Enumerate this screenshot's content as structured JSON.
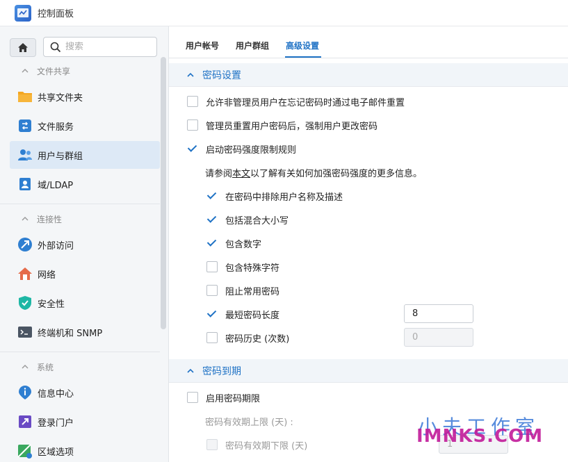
{
  "window": {
    "title": "控制面板"
  },
  "search": {
    "placeholder": "搜索"
  },
  "sidebar": {
    "groups": [
      {
        "label": "文件共享"
      },
      {
        "label": "连接性"
      },
      {
        "label": "系统"
      }
    ],
    "items": [
      {
        "label": "共享文件夹",
        "icon": "folder-icon"
      },
      {
        "label": "文件服务",
        "icon": "file-services-icon"
      },
      {
        "label": "用户与群组",
        "icon": "users-icon",
        "active": true
      },
      {
        "label": "域/LDAP",
        "icon": "domain-icon"
      },
      {
        "label": "外部访问",
        "icon": "external-access-icon"
      },
      {
        "label": "网络",
        "icon": "network-icon"
      },
      {
        "label": "安全性",
        "icon": "shield-icon"
      },
      {
        "label": "终端机和 SNMP",
        "icon": "terminal-icon"
      },
      {
        "label": "信息中心",
        "icon": "info-icon"
      },
      {
        "label": "登录门户",
        "icon": "login-portal-icon"
      },
      {
        "label": "区域选项",
        "icon": "region-icon"
      }
    ]
  },
  "tabs": [
    {
      "label": "用户帐号"
    },
    {
      "label": "用户群组"
    },
    {
      "label": "高级设置",
      "active": true
    }
  ],
  "password_settings": {
    "title": "密码设置",
    "options": [
      {
        "label": "允许非管理员用户在忘记密码时通过电子邮件重置",
        "checked": false
      },
      {
        "label": "管理员重置用户密码后，强制用户更改密码",
        "checked": false
      },
      {
        "label": "启动密码强度限制规则",
        "checked": true
      }
    ],
    "hint_prefix": "请参阅",
    "hint_link": "本文",
    "hint_suffix": "以了解有关如何加强密码强度的更多信息。",
    "rules": [
      {
        "label": "在密码中排除用户名称及描述",
        "checked": true
      },
      {
        "label": "包括混合大小写",
        "checked": true
      },
      {
        "label": "包含数字",
        "checked": true
      },
      {
        "label": "包含特殊字符",
        "checked": false
      },
      {
        "label": "阻止常用密码",
        "checked": false
      },
      {
        "label": "最短密码长度",
        "checked": true,
        "value": "8"
      },
      {
        "label": "密码历史 (次数)",
        "checked": false,
        "value": "0"
      }
    ]
  },
  "password_expiry": {
    "title": "密码到期",
    "enable_label": "启用密码期限",
    "upper_limit_label": "密码有效期上限 (天) :",
    "lower_limit_label": "密码有效期下限 (天)",
    "lower_limit_value": "1"
  },
  "watermark": {
    "cn": "小夫工作室",
    "en": "IMNKS.COM"
  },
  "colors": {
    "accent": "#1f72c5",
    "sidebar_bg": "#f4f6f8",
    "section_bg": "#f1f5f9"
  }
}
